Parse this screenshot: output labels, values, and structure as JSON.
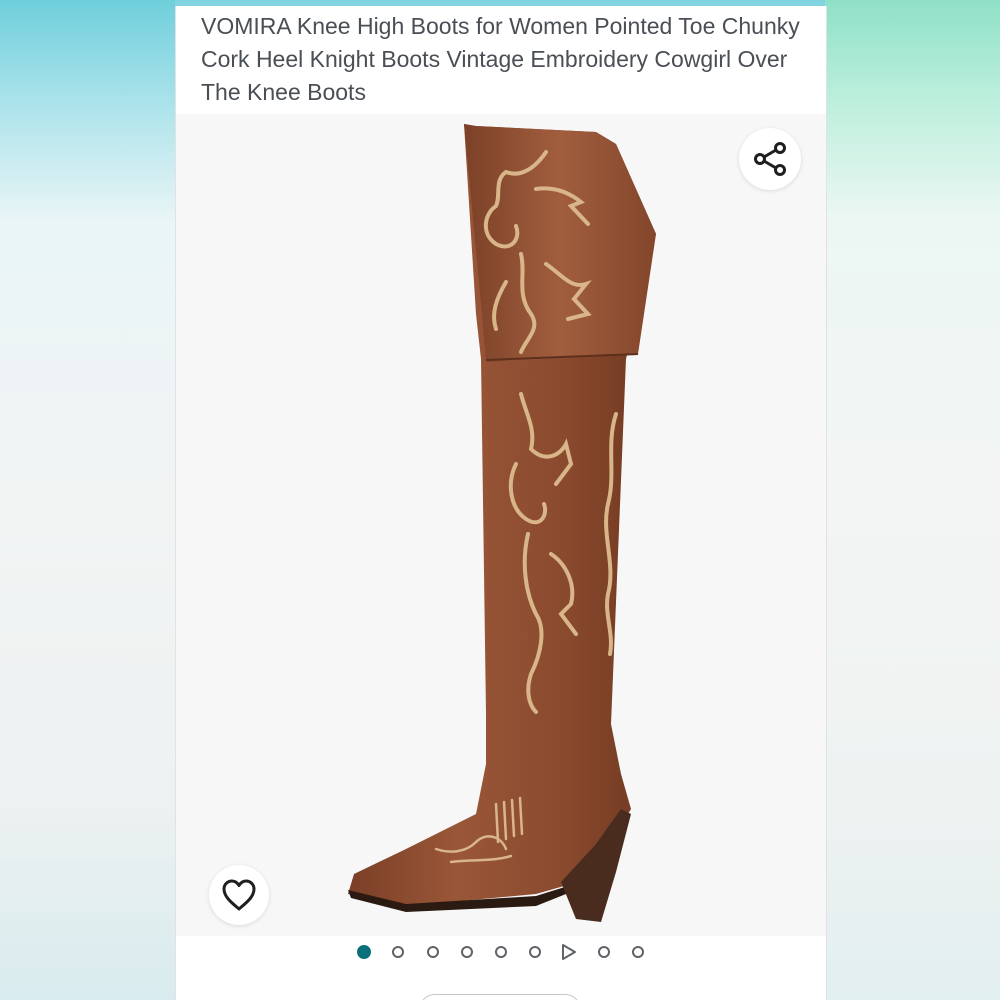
{
  "product": {
    "title": "VOMIRA Knee High Boots for Women Pointed Toe Chunky Cork Heel Knight Boots Vintage Embroidery Cowgirl Over The Knee Boots"
  },
  "image": {
    "subject": "boot-image",
    "boot_color": "#8e4c30",
    "stitch_color": "#d9b58a",
    "heel_color": "#4a2c1f"
  },
  "actions": {
    "share_icon": "share-icon",
    "favorite_icon": "heart-icon"
  },
  "carousel": {
    "active_index": 0,
    "accent_color": "#0b6f7c",
    "items": [
      {
        "type": "image"
      },
      {
        "type": "image"
      },
      {
        "type": "image"
      },
      {
        "type": "image"
      },
      {
        "type": "image"
      },
      {
        "type": "image"
      },
      {
        "type": "video"
      },
      {
        "type": "image"
      },
      {
        "type": "image"
      }
    ]
  }
}
